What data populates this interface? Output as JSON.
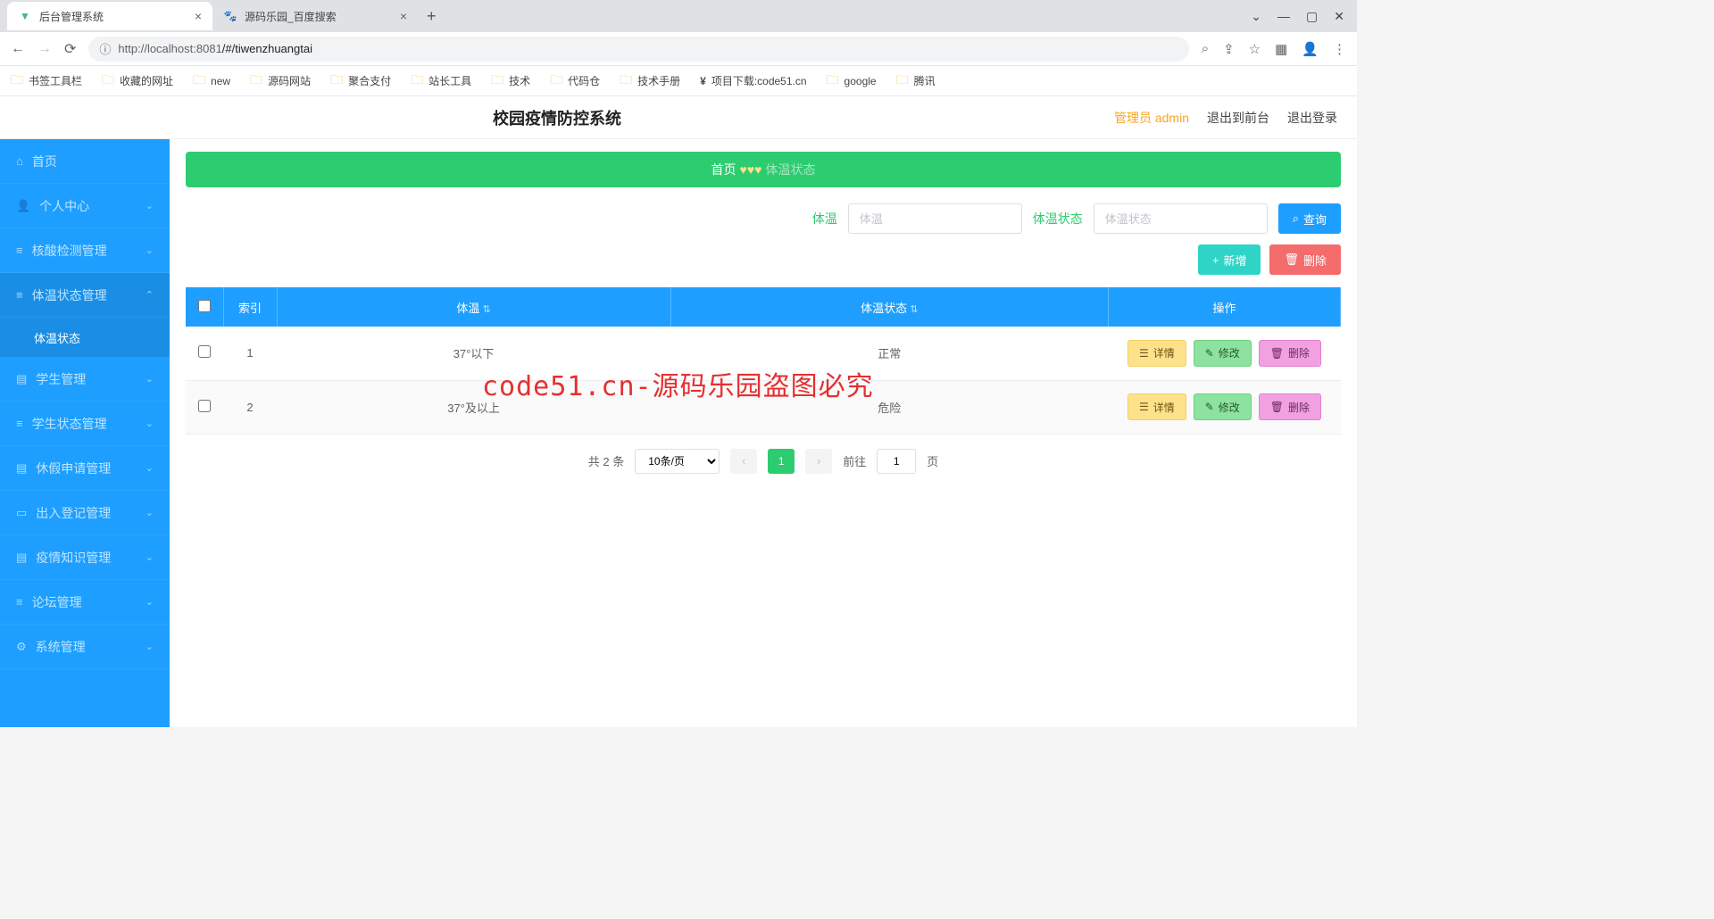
{
  "browser": {
    "tabs": [
      {
        "title": "后台管理系统",
        "active": true
      },
      {
        "title": "源码乐园_百度搜索",
        "active": false
      }
    ],
    "url_host": "http://localhost:",
    "url_port": "8081",
    "url_path": "/#/tiwenzhuangtai",
    "bookmarks": [
      "书签工具栏",
      "收藏的网址",
      "new",
      "源码网站",
      "聚合支付",
      "站长工具",
      "技术",
      "代码仓",
      "技术手册",
      "项目下载:code51.cn",
      "google",
      "腾讯"
    ]
  },
  "header": {
    "title": "校园疫情防控系统",
    "user": "管理员 admin",
    "front_link": "退出到前台",
    "logout_link": "退出登录"
  },
  "sidebar": {
    "items": [
      {
        "label": "首页",
        "icon": "home"
      },
      {
        "label": "个人中心",
        "icon": "user",
        "expandable": true
      },
      {
        "label": "核酸检测管理",
        "icon": "bars",
        "expandable": true
      },
      {
        "label": "体温状态管理",
        "icon": "list",
        "expandable": true,
        "expanded": true,
        "sub": "体温状态"
      },
      {
        "label": "学生管理",
        "icon": "doc",
        "expandable": true
      },
      {
        "label": "学生状态管理",
        "icon": "list",
        "expandable": true
      },
      {
        "label": "休假申请管理",
        "icon": "doc",
        "expandable": true
      },
      {
        "label": "出入登记管理",
        "icon": "card",
        "expandable": true
      },
      {
        "label": "疫情知识管理",
        "icon": "doc",
        "expandable": true
      },
      {
        "label": "论坛管理",
        "icon": "bars",
        "expandable": true
      },
      {
        "label": "系统管理",
        "icon": "gear",
        "expandable": true
      }
    ]
  },
  "breadcrumb": {
    "home": "首页",
    "current": "体温状态"
  },
  "filter": {
    "label1": "体温",
    "ph1": "体温",
    "label2": "体温状态",
    "ph2": "体温状态",
    "search_btn": "查询"
  },
  "actions": {
    "add": "新增",
    "delete": "删除"
  },
  "table": {
    "headers": {
      "index": "索引",
      "temp": "体温",
      "status": "体温状态",
      "ops": "操作"
    },
    "rows": [
      {
        "idx": "1",
        "temp": "37°以下",
        "status": "正常"
      },
      {
        "idx": "2",
        "temp": "37°及以上",
        "status": "危险"
      }
    ],
    "row_ops": {
      "detail": "详情",
      "edit": "修改",
      "del": "删除"
    }
  },
  "pager": {
    "total": "共 2 条",
    "size": "10条/页",
    "page": "1",
    "goto_prefix": "前往",
    "goto_val": "1",
    "goto_suffix": "页"
  },
  "watermark": "code51.cn-源码乐园盗图必究"
}
